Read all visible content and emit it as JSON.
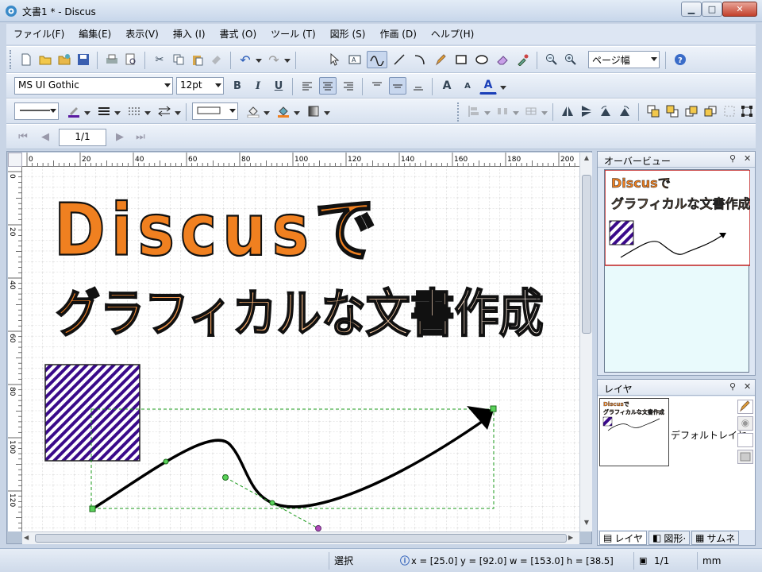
{
  "window": {
    "title": "文書1 * - Discus",
    "min_label": "▁",
    "max_label": "□",
    "close_label": "✕"
  },
  "menu": [
    "ファイル(F)",
    "編集(E)",
    "表示(V)",
    "挿入 (I)",
    "書式 (O)",
    "ツール (T)",
    "図形 (S)",
    "作画 (D)",
    "ヘルプ(H)"
  ],
  "toolbar": {
    "zoom_value": "ページ幅",
    "font_name": "MS UI Gothic",
    "font_size": "12pt",
    "bold": "B",
    "italic": "I",
    "underline": "U",
    "grow_font": "A",
    "shrink_font": "A",
    "font_color": "A"
  },
  "nav": {
    "page_value": "1/1"
  },
  "ruler": {
    "h_ticks": [
      "0",
      "20",
      "40",
      "60",
      "80",
      "100",
      "120",
      "140",
      "160",
      "180",
      "200"
    ],
    "v_ticks": [
      "0",
      "20",
      "40",
      "60",
      "80",
      "100",
      "120"
    ]
  },
  "document": {
    "title_line1": "Discusで",
    "title_line2": "グラフィカルな文書作成",
    "colors": {
      "title_orange": "#f08020",
      "title_light": "#fbe6d6",
      "hatch": "#3a0a8a",
      "grid": "#c8c8c8"
    }
  },
  "overview": {
    "title": "オーバービュー",
    "thumb_line1": "Discusで",
    "thumb_line2": "グラフィカルな文書作成"
  },
  "layers": {
    "title": "レイヤ",
    "layer_name": "デフォルトレイヤ",
    "thumb_line1": "Discusで",
    "thumb_line2": "グラフィカルな文書作成",
    "tabs": [
      "レイヤ",
      "図形·",
      "サムネ"
    ]
  },
  "status": {
    "mode": "選択",
    "geometry": "x = [25.0] y = [92.0] w = [153.0] h = [38.5]",
    "pages": "1/1",
    "unit": "mm"
  }
}
